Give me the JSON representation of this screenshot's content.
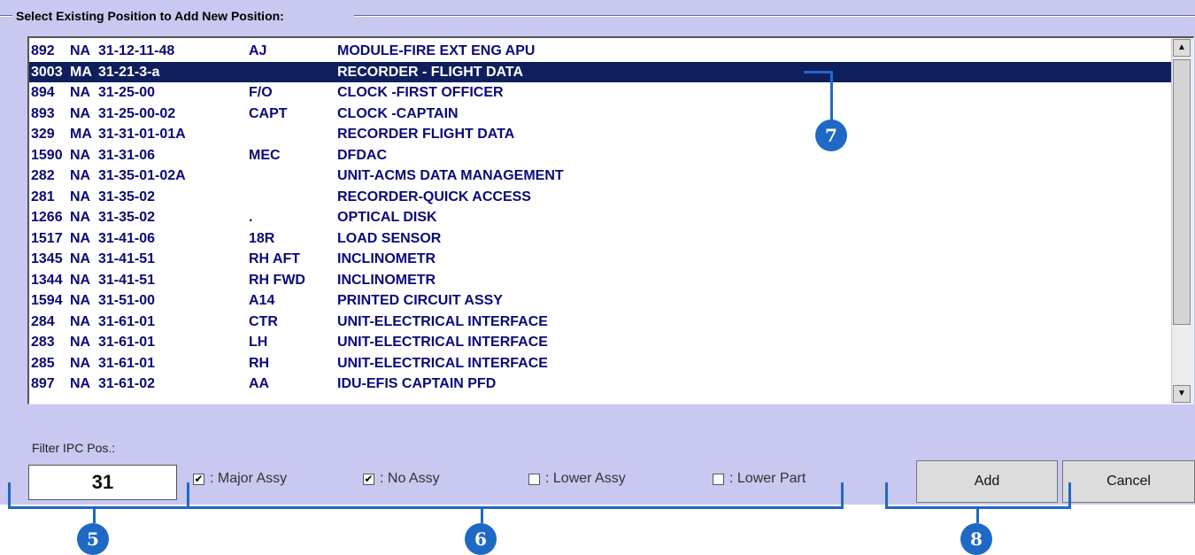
{
  "group_title": "Select Existing Position to Add New Position:",
  "rows": [
    {
      "c1": "892",
      "c2": "NA",
      "c3": "31-12-11-48",
      "c4": "AJ",
      "c5": "MODULE-FIRE EXT ENG APU"
    },
    {
      "c1": "3003",
      "c2": "MA",
      "c3": "31-21-3-a",
      "c4": "",
      "c5": "RECORDER - FLIGHT DATA"
    },
    {
      "c1": "894",
      "c2": "NA",
      "c3": "31-25-00",
      "c4": "F/O",
      "c5": "CLOCK -FIRST OFFICER"
    },
    {
      "c1": "893",
      "c2": "NA",
      "c3": "31-25-00-02",
      "c4": "CAPT",
      "c5": "CLOCK -CAPTAIN"
    },
    {
      "c1": "329",
      "c2": "MA",
      "c3": "31-31-01-01A",
      "c4": "",
      "c5": "RECORDER FLIGHT DATA"
    },
    {
      "c1": "1590",
      "c2": "NA",
      "c3": "31-31-06",
      "c4": "MEC",
      "c5": "DFDAC"
    },
    {
      "c1": "282",
      "c2": "NA",
      "c3": "31-35-01-02A",
      "c4": "",
      "c5": "UNIT-ACMS DATA MANAGEMENT"
    },
    {
      "c1": "281",
      "c2": "NA",
      "c3": "31-35-02",
      "c4": "",
      "c5": "RECORDER-QUICK ACCESS"
    },
    {
      "c1": "1266",
      "c2": "NA",
      "c3": "31-35-02",
      "c4": ".",
      "c5": "OPTICAL DISK"
    },
    {
      "c1": "1517",
      "c2": "NA",
      "c3": "31-41-06",
      "c4": "18R",
      "c5": "LOAD SENSOR"
    },
    {
      "c1": "1345",
      "c2": "NA",
      "c3": "31-41-51",
      "c4": "RH AFT",
      "c5": "INCLINOMETR"
    },
    {
      "c1": "1344",
      "c2": "NA",
      "c3": "31-41-51",
      "c4": "RH FWD",
      "c5": "INCLINOMETR"
    },
    {
      "c1": "1594",
      "c2": "NA",
      "c3": "31-51-00",
      "c4": "A14",
      "c5": "PRINTED CIRCUIT ASSY"
    },
    {
      "c1": "284",
      "c2": "NA",
      "c3": "31-61-01",
      "c4": "CTR",
      "c5": "UNIT-ELECTRICAL INTERFACE"
    },
    {
      "c1": "283",
      "c2": "NA",
      "c3": "31-61-01",
      "c4": "LH",
      "c5": "UNIT-ELECTRICAL INTERFACE"
    },
    {
      "c1": "285",
      "c2": "NA",
      "c3": "31-61-01",
      "c4": "RH",
      "c5": "UNIT-ELECTRICAL INTERFACE"
    },
    {
      "c1": "897",
      "c2": "NA",
      "c3": "31-61-02",
      "c4": "AA",
      "c5": "IDU-EFIS CAPTAIN PFD"
    }
  ],
  "selected_row_index": 1,
  "filter": {
    "label": "Filter IPC Pos.:",
    "value": "31"
  },
  "checkboxes": [
    {
      "label": ": Major Assy",
      "checked": true
    },
    {
      "label": ": No Assy",
      "checked": true
    },
    {
      "label": ": Lower Assy",
      "checked": false
    },
    {
      "label": ": Lower Part",
      "checked": false
    }
  ],
  "buttons": {
    "add": "Add",
    "cancel": "Cancel"
  },
  "callouts": {
    "c5": "5",
    "c6": "6",
    "c7": "7",
    "c8": "8"
  },
  "scroll": {
    "up_icon": "▲",
    "down_icon": "▼"
  },
  "colors": {
    "panel": "#c8c8f0",
    "selection": "#0f1f5e",
    "row_text": "#0a0a78",
    "callout": "#1f69c4"
  }
}
